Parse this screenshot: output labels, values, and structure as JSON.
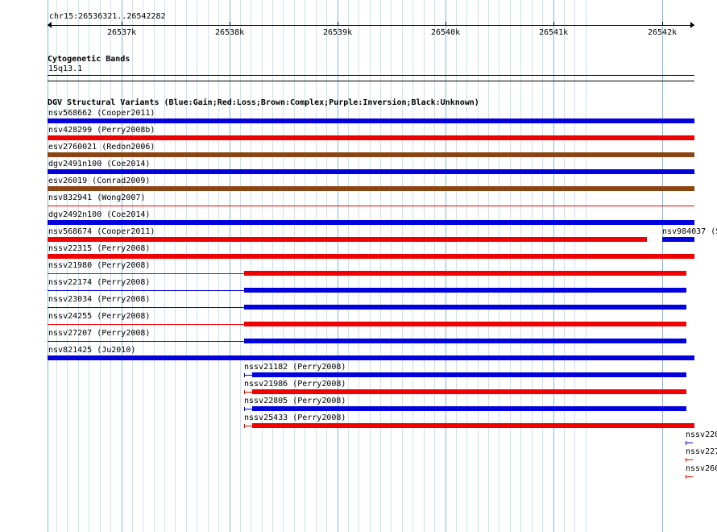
{
  "ruler": {
    "chrom_label": "chr15:26536321..26542282",
    "ticks": [
      "26537k",
      "26538k",
      "26539k",
      "26540k",
      "26541k",
      "26542k"
    ]
  },
  "cytoband": {
    "title": "Cytogenetic Bands",
    "band": "15q13.1"
  },
  "dgv": {
    "title": "DGV Structural Variants (Blue:Gain;Red:Loss;Brown:Complex;Purple:Inversion;Black:Unknown)",
    "colors": {
      "gain": "#0000dd",
      "loss": "#ee0000",
      "complex": "#8b4513"
    },
    "variants": [
      {
        "label": "nsv568662 (Cooper2011)",
        "type": "gain"
      },
      {
        "label": "nsv428299 (Perry2008b)",
        "type": "loss"
      },
      {
        "label": "esv2760021 (Redon2006)",
        "type": "complex"
      },
      {
        "label": "dgv2491n100 (Coe2014)",
        "type": "gain"
      },
      {
        "label": "esv26019 (Conrad2009)",
        "type": "complex"
      },
      {
        "label": "nsv832941 (Wong2007)",
        "type": "loss"
      },
      {
        "label": "dgv2492n100 (Coe2014)",
        "type": "gain"
      },
      {
        "label": "nsv568674 (Cooper2011)",
        "type": "loss"
      },
      {
        "label": "nsv984037 (S",
        "type": "gain"
      },
      {
        "label": "nssv22315 (Perry2008)",
        "type": "loss"
      },
      {
        "label": "nssv21980 (Perry2008)",
        "type": "loss"
      },
      {
        "label": "nssv22174 (Perry2008)",
        "type": "gain"
      },
      {
        "label": "nssv23034 (Perry2008)",
        "type": "gain"
      },
      {
        "label": "nssv24255 (Perry2008)",
        "type": "loss"
      },
      {
        "label": "nssv27207 (Perry2008)",
        "type": "gain"
      },
      {
        "label": "nsv821425 (Ju2010)",
        "type": "gain"
      },
      {
        "label": "nssv21182 (Perry2008)",
        "type": "gain"
      },
      {
        "label": "nssv21986 (Perry2008)",
        "type": "loss"
      },
      {
        "label": "nssv22805 (Perry2008)",
        "type": "gain"
      },
      {
        "label": "nssv25433 (Perry2008)",
        "type": "loss"
      },
      {
        "label": "nssv220",
        "type": "gain"
      },
      {
        "label": "nssv227",
        "type": "loss"
      },
      {
        "label": "nssv260",
        "type": "loss"
      }
    ]
  }
}
